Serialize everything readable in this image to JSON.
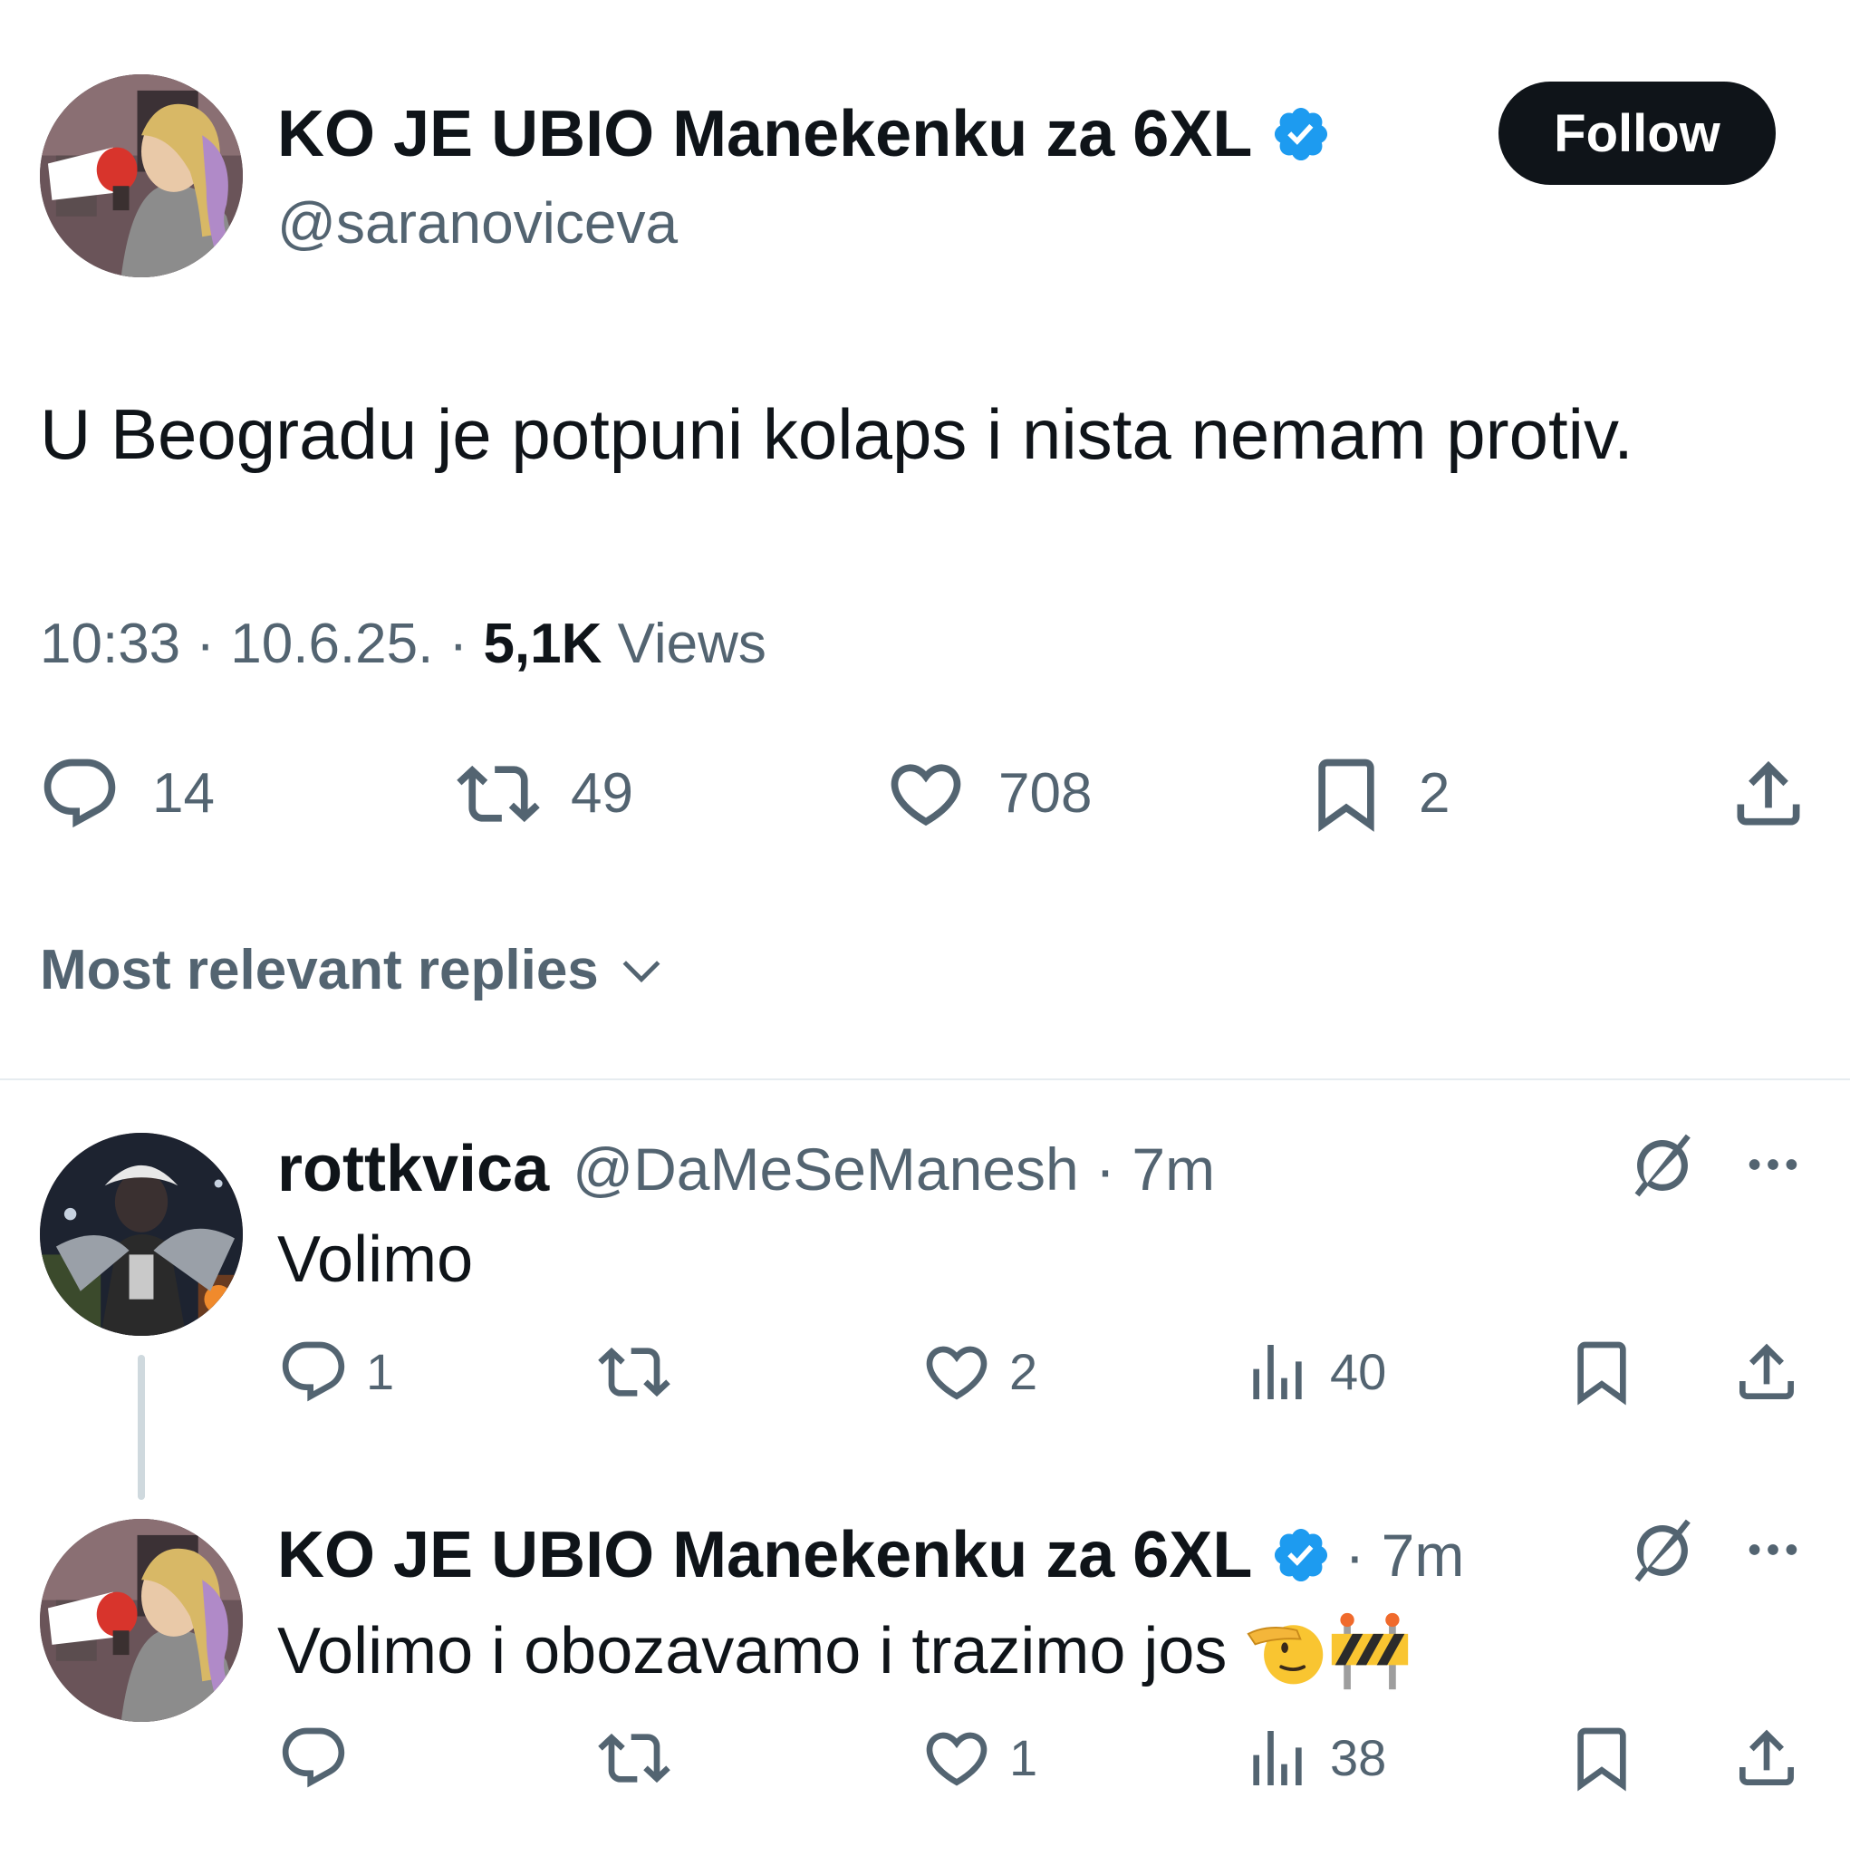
{
  "tweet": {
    "author": {
      "display_name": "KO JE UBIO Manekenku za 6XL",
      "handle": "@saranoviceva",
      "verified": true
    },
    "follow_label": "Follow",
    "text": "U Beogradu je potpuni kolaps i nista nemam protiv.",
    "time": "10:33 · 10.6.25. · ",
    "views_count": "5,1K",
    "views_label": " Views",
    "stats": {
      "replies": "14",
      "reposts": "49",
      "likes": "708",
      "bookmarks": "2"
    }
  },
  "replies_sort_label": "Most relevant replies",
  "replies": [
    {
      "display_name": "rottkvica",
      "handle_time": "@DaMeSeManesh · 7m",
      "text": "Volimo",
      "stats": {
        "replies": "1",
        "reposts": "",
        "likes": "2",
        "views": "40"
      }
    },
    {
      "display_name": "KO JE UBIO Manekenku za 6XL",
      "verified": true,
      "handle_time": "· 7m",
      "text": "Volimo i obozavamo i trazimo jos",
      "emojis": [
        "saluting-face-emoji",
        "construction-emoji"
      ],
      "stats": {
        "replies": "",
        "reposts": "",
        "likes": "1",
        "views": "38"
      }
    }
  ],
  "colors": {
    "text_primary": "#0f1419",
    "text_secondary": "#536471",
    "verified_blue": "#1d9bf0",
    "follow_bg": "#0f1419",
    "divider": "#e6ecf0"
  }
}
